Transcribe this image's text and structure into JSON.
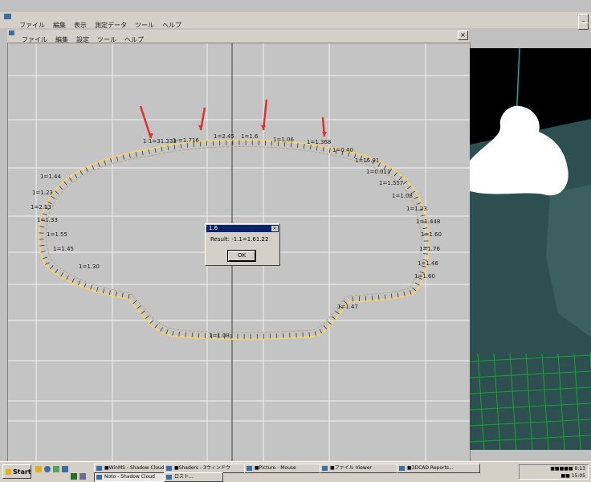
{
  "app": {
    "menu": [
      "ファイル",
      "編集",
      "表示",
      "測定データ",
      "ツール",
      "ヘルプ"
    ]
  },
  "drawing_window": {
    "menu": [
      "ファイル",
      "編集",
      "設定",
      "ツール",
      "ヘルプ"
    ],
    "close_glyph": "×"
  },
  "labels": [
    "1-1=31.333",
    "1-=1.716",
    "1=2.45",
    "1=1.6",
    "1=1.06",
    "1=1.368",
    "1=0.40",
    "1=15.91",
    "1=0.011",
    "1=1.557",
    "1=1.08",
    "1=1.23",
    "1=1.448",
    "1=1.60",
    "1=1.76",
    "1=1.46",
    "1=1.60",
    "1=1.44",
    "1=1.23",
    "1=2.53",
    "1=1.33",
    "1=1.55",
    "1=1.45",
    "1=1.30",
    "1=1.08",
    "1=1.47"
  ],
  "dialog": {
    "title": "1.6",
    "message": "Result: -1.1=1.61.22",
    "ok_label": "OK",
    "close_glyph": "×"
  },
  "taskbar": {
    "start_label": "Start",
    "tasks": [
      "■WinMS - Shadow Cloudin",
      "■Shaders - 3ウィンドウ",
      "■Picture - Mouse",
      "■ファイル Viewer",
      "■3DCAD Reports..."
    ],
    "task_row2": [
      "Noto - Shadow Cloud",
      "ロスト..."
    ],
    "clock_line1": "■■■■■ 8:13",
    "clock_line2": "■■ 15:05"
  },
  "colors": {
    "canvas": "#c4c4c4",
    "grid": "#f2f2f2",
    "outline": "#f1d27a",
    "arrow": "#e03030",
    "floor": "#2e4f50",
    "grid_green": "#16a33a",
    "axis_teal": "#1aa6a6"
  }
}
